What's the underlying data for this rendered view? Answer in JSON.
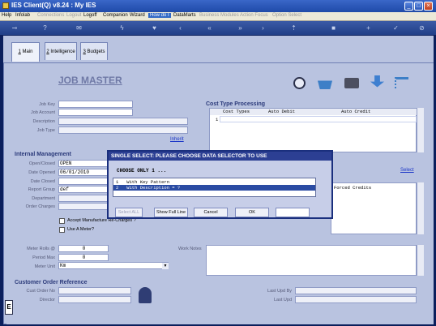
{
  "window": {
    "title": "IES Client(Q) v8.24 : My IES"
  },
  "menu": [
    "Help",
    "Infolab",
    "Connections",
    "Logout",
    "Logoff",
    "Companion",
    "Wizard",
    "How do I",
    "DataMarts",
    "Business Modules",
    "Action Focus",
    "Option Select"
  ],
  "tabs": [
    {
      "num": "1",
      "label": "Main"
    },
    {
      "num": "2",
      "label": "Intelligence"
    },
    {
      "num": "3",
      "label": "Budgets"
    }
  ],
  "page_title": "JOB MASTER",
  "job": {
    "key_label": "Job Key",
    "account_label": "Job Account",
    "description_label": "Description",
    "type_label": "Job Type",
    "inherit_link": "Inherit"
  },
  "cost_type": {
    "heading": "Cost Type Processing",
    "col1": "Cost Types",
    "col2": "Auto Debit",
    "col3": "Auto Credit",
    "row1_num": "1",
    "select_link": "Select",
    "forced_credits": "Forced Credits"
  },
  "internal": {
    "heading": "Internal Management",
    "open_label": "Open/Closed",
    "open_value": "OPEN",
    "date_opened_label": "Date Opened",
    "date_opened_value": "06/01/2010",
    "date_closed_label": "Date Closed",
    "report_group_label": "Report Group",
    "report_group_value": "def",
    "department_label": "Department",
    "order_charges_label": "Order Charges",
    "accept_manufacture_label": "Accept Manufacture Re-Charges ?",
    "use_meter_label": "Use A Meter?"
  },
  "meter": {
    "rolls_label": "Meter Rolls @",
    "rolls_value": "0",
    "period_label": "Period Max",
    "period_value": "0",
    "unit_label": "Meter Unit",
    "unit_value": "Km",
    "work_notes_label": "Work Notes"
  },
  "customer": {
    "heading": "Customer Order Reference",
    "order_no_label": "Cust Order No",
    "director_label": "Director",
    "last_upd_by_label": "Last Upd By",
    "last_upd_label": "Last Upd"
  },
  "modal": {
    "title": "SINGLE SELECT: PLEASE CHOOSE DATA SELECTOR TO USE",
    "prompt": "CHOOSE ONLY 1 ...",
    "options": [
      "1   With Key Pattern",
      "2   With Description = ?"
    ],
    "buttons": {
      "select_all": "Select ALL",
      "show_full_line": "Show Full Line",
      "cancel": "Cancel",
      "ok": "OK"
    }
  }
}
